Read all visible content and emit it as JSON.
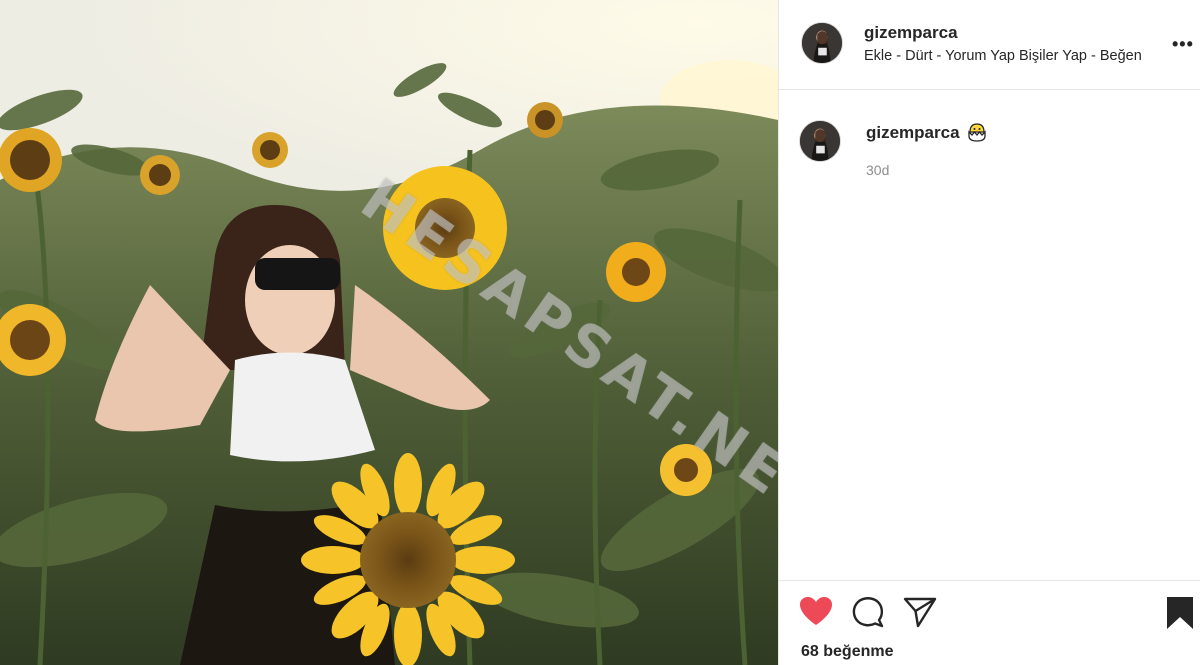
{
  "post": {
    "image_alt": "Girl in sunglasses posing in a sunflower field",
    "watermark": "HESAPSAT.NET"
  },
  "header": {
    "username": "gizemparca",
    "subtitle": "Ekle - Dürt - Yorum Yap Bişiler Yap - Beğen",
    "more_icon": "more-icon"
  },
  "caption": {
    "username": "gizemparca",
    "emoji_icon": "hatching-chick-icon",
    "time": "30d"
  },
  "actions": {
    "like_icon": "heart-icon",
    "liked": true,
    "like_color": "#ed4956",
    "comment_icon": "comment-icon",
    "share_icon": "share-icon",
    "save_icon": "bookmark-icon",
    "likes_text": "68 beğenme"
  }
}
